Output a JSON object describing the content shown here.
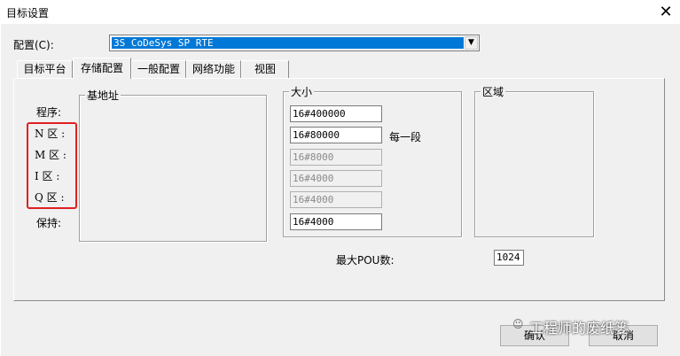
{
  "window": {
    "title": "目标设置"
  },
  "config": {
    "label": "配置(C):",
    "selected": "3S CoDeSys SP RTE"
  },
  "tabs": [
    "目标平台",
    "存储配置",
    "一般配置",
    "网络功能",
    "视图"
  ],
  "left_labels": {
    "program": "程序:",
    "n": "N 区 :",
    "m": "M 区 :",
    "i": "I 区 :",
    "q": "Q 区 :",
    "retain": "保持:"
  },
  "groups": {
    "base": "基地址",
    "size": "大小",
    "area": "区域"
  },
  "sizes": {
    "program": "16#400000",
    "n": "16#80000",
    "m": "16#8000",
    "i": "16#4000",
    "q": "16#4000",
    "retain": "16#4000",
    "per_segment": "每一段"
  },
  "pou": {
    "label": "最大POU数:",
    "value": "1024"
  },
  "buttons": {
    "ok": "确认",
    "cancel": "取消"
  },
  "watermark": "工程师的废纸篓"
}
